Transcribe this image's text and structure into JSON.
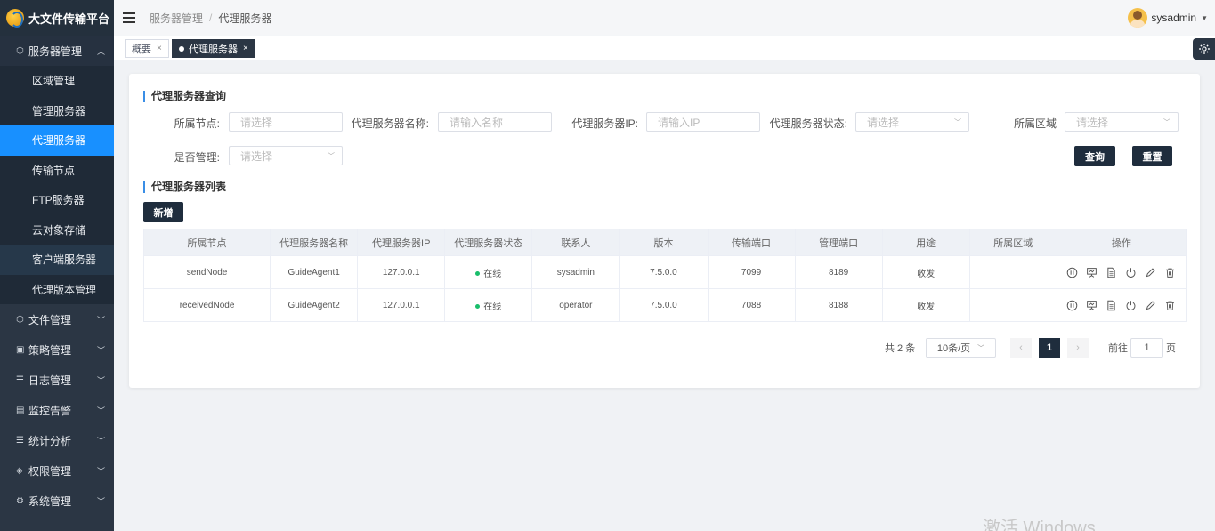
{
  "app": {
    "title": "大文件传输平台"
  },
  "sidebar": {
    "groups": [
      {
        "label": "服务器管理",
        "icon": "cube-icon",
        "open": true,
        "items": [
          {
            "label": "区域管理"
          },
          {
            "label": "管理服务器"
          },
          {
            "label": "代理服务器",
            "active": true
          },
          {
            "label": "传输节点"
          },
          {
            "label": "FTP服务器"
          },
          {
            "label": "云对象存储"
          },
          {
            "label": "客户端服务器"
          },
          {
            "label": "代理版本管理"
          }
        ]
      },
      {
        "label": "文件管理",
        "icon": "cube-icon"
      },
      {
        "label": "策略管理",
        "icon": "briefcase-icon"
      },
      {
        "label": "日志管理",
        "icon": "list-icon"
      },
      {
        "label": "监控告警",
        "icon": "monitor-icon"
      },
      {
        "label": "统计分析",
        "icon": "list-icon"
      },
      {
        "label": "权限管理",
        "icon": "layers-icon"
      },
      {
        "label": "系统管理",
        "icon": "gear-icon"
      }
    ]
  },
  "header": {
    "breadcrumb": [
      "服务器管理",
      "代理服务器"
    ],
    "breadcrumb_sep": "/",
    "user": "sysadmin"
  },
  "tabs": [
    {
      "label": "概要",
      "close": "×"
    },
    {
      "label": "代理服务器",
      "close": "×",
      "active": true
    }
  ],
  "query": {
    "title": "代理服务器查询",
    "fields": [
      {
        "label": "所属节点:",
        "placeholder": "请选择"
      },
      {
        "label": "代理服务器名称:",
        "placeholder": "请输入名称"
      },
      {
        "label": "代理服务器IP:",
        "placeholder": "请输入IP"
      },
      {
        "label": "代理服务器状态:",
        "placeholder": "请选择"
      },
      {
        "label": "所属区域",
        "placeholder": "请选择"
      },
      {
        "label": "是否管理:",
        "placeholder": "请选择"
      }
    ],
    "search_label": "查询",
    "reset_label": "重置"
  },
  "list": {
    "title": "代理服务器列表",
    "add_label": "新增",
    "columns": [
      "所属节点",
      "代理服务器名称",
      "代理服务器IP",
      "代理服务器状态",
      "联系人",
      "版本",
      "传输端口",
      "管理端口",
      "用途",
      "所属区域",
      "操作"
    ],
    "rows": [
      {
        "node": "sendNode",
        "name": "GuideAgent1",
        "ip": "127.0.0.1",
        "status": "在线",
        "contact": "sysadmin",
        "version": "7.5.0.0",
        "transfer_port": "7099",
        "manage_port": "8189",
        "usage": "收发",
        "region": ""
      },
      {
        "node": "receivedNode",
        "name": "GuideAgent2",
        "ip": "127.0.0.1",
        "status": "在线",
        "contact": "operator",
        "version": "7.5.0.0",
        "transfer_port": "7088",
        "manage_port": "8188",
        "usage": "收发",
        "region": ""
      }
    ],
    "row_actions": [
      "pause-icon",
      "monitor-icon",
      "document-icon",
      "power-icon",
      "edit-icon",
      "delete-icon"
    ],
    "status_color": "#19be6b"
  },
  "pagination": {
    "total": "共 2 条",
    "page_size": "10条/页",
    "current": "1",
    "goto_prefix": "前往",
    "goto_value": "1",
    "goto_suffix": "页"
  },
  "watermark": "激活 Windows",
  "colors": {
    "sidebar": "#2b3644",
    "active": "#1890ff",
    "dark_button": "#1f2d3d",
    "accent_bar": "#3a8ee6"
  }
}
